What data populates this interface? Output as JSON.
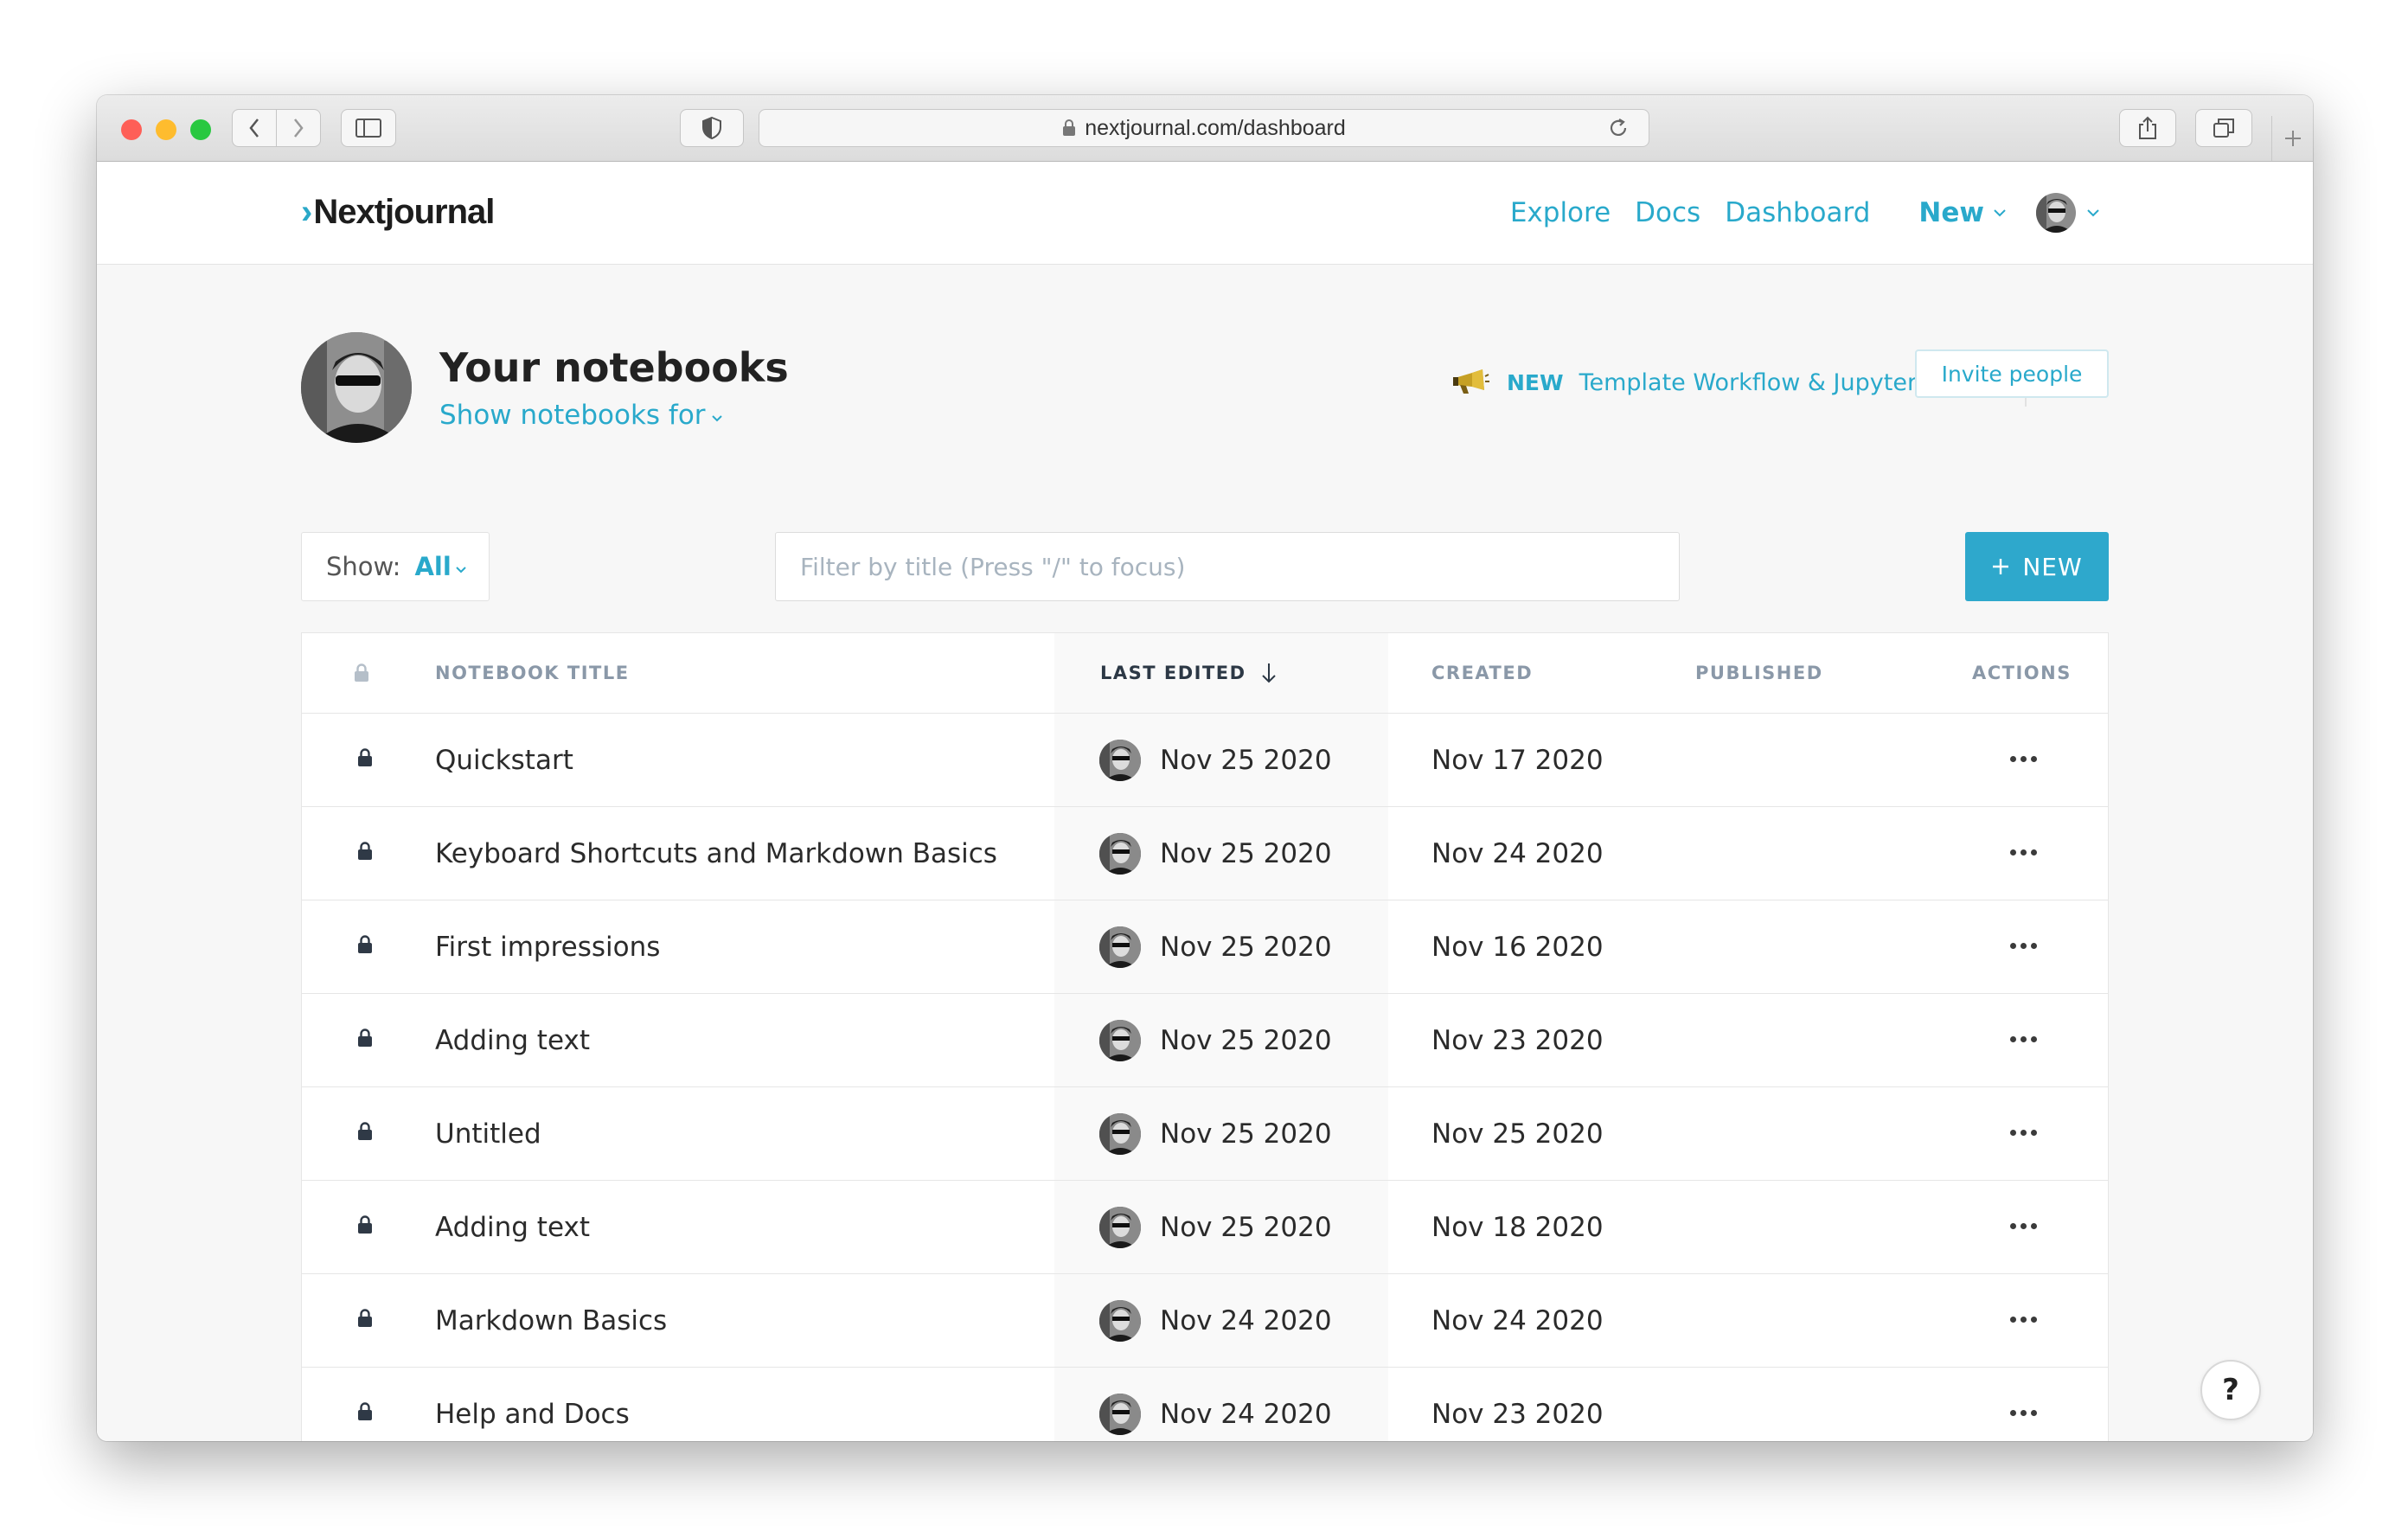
{
  "browser": {
    "url": "nextjournal.com/dashboard",
    "traffic_lights": {
      "close": "#fe5f57",
      "minimize": "#febc2e",
      "zoom": "#28c840"
    }
  },
  "navbar": {
    "brand_chevron": "›",
    "brand": "Nextjournal",
    "links": [
      "Explore",
      "Docs",
      "Dashboard"
    ],
    "new_menu": "New",
    "accent_color": "#29a9cb"
  },
  "header": {
    "title": "Your notebooks",
    "subtitle": "Show notebooks for",
    "announcement_badge": "NEW",
    "announcement_text": "Template Workflow & Jupyter Export",
    "invite_label": "Invite people"
  },
  "toolbar": {
    "show_label": "Show:",
    "show_value": "All",
    "filter_placeholder": "Filter by title (Press \"/\" to focus)",
    "new_button": "NEW"
  },
  "table": {
    "columns": {
      "title": "NOTEBOOK TITLE",
      "last_edited": "LAST EDITED",
      "created": "CREATED",
      "published": "PUBLISHED",
      "actions": "ACTIONS"
    },
    "sort_column": "last_edited",
    "sort_direction": "descending",
    "rows": [
      {
        "title": "Quickstart",
        "last_edited": "Nov 25 2020",
        "created": "Nov 17 2020",
        "published": ""
      },
      {
        "title": "Keyboard Shortcuts and Markdown Basics",
        "last_edited": "Nov 25 2020",
        "created": "Nov 24 2020",
        "published": ""
      },
      {
        "title": "First impressions",
        "last_edited": "Nov 25 2020",
        "created": "Nov 16 2020",
        "published": ""
      },
      {
        "title": "Adding text",
        "last_edited": "Nov 25 2020",
        "created": "Nov 23 2020",
        "published": ""
      },
      {
        "title": "Untitled",
        "last_edited": "Nov 25 2020",
        "created": "Nov 25 2020",
        "published": ""
      },
      {
        "title": "Adding text",
        "last_edited": "Nov 25 2020",
        "created": "Nov 18 2020",
        "published": ""
      },
      {
        "title": "Markdown Basics",
        "last_edited": "Nov 24 2020",
        "created": "Nov 24 2020",
        "published": ""
      },
      {
        "title": "Help and Docs",
        "last_edited": "Nov 24 2020",
        "created": "Nov 23 2020",
        "published": ""
      }
    ]
  },
  "help_button": "?"
}
